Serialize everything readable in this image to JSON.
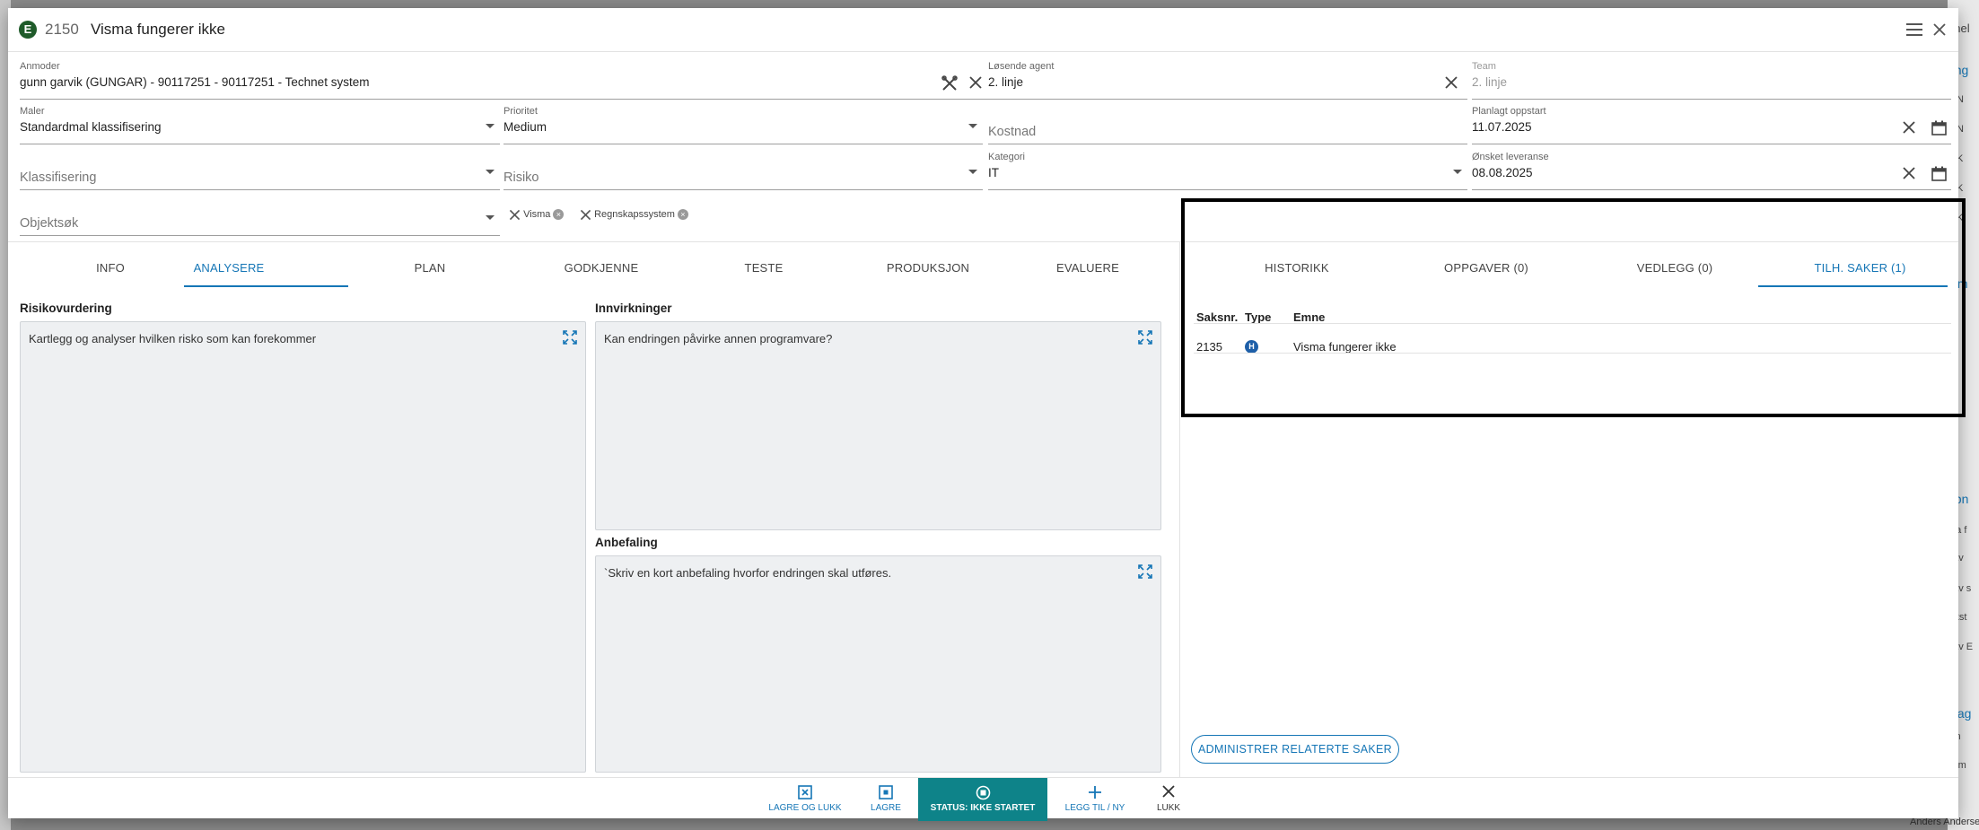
{
  "modal": {
    "badge": "E",
    "case_number": "2150",
    "title": "Visma fungerer ikke"
  },
  "fields": {
    "anmoder": {
      "label": "Anmoder",
      "value": "gunn garvik (GUNGAR) - 90117251 - 90117251 - Technet system"
    },
    "losende_agent": {
      "label": "Løsende agent",
      "value": "2. linje"
    },
    "team": {
      "label": "Team",
      "value": "2. linje"
    },
    "maler": {
      "label": "Maler",
      "value": "Standardmal klassifisering"
    },
    "prioritet": {
      "label": "Prioritet",
      "value": "Medium"
    },
    "kostnad": {
      "placeholder": "Kostnad"
    },
    "planlagt_oppstart": {
      "label": "Planlagt oppstart",
      "value": "11.07.2025"
    },
    "klassifisering": {
      "placeholder": "Klassifisering"
    },
    "risiko": {
      "placeholder": "Risiko"
    },
    "kategori": {
      "label": "Kategori",
      "value": "IT"
    },
    "onsket_leveranse": {
      "label": "Ønsket leveranse",
      "value": "08.08.2025"
    },
    "objektsok": {
      "placeholder": "Objektsøk"
    }
  },
  "chips": [
    "Visma",
    "Regnskapssystem"
  ],
  "left_tabs": [
    "INFO",
    "ANALYSERE",
    "PLAN",
    "GODKJENNE",
    "TESTE",
    "PRODUKSJON",
    "EVALUERE"
  ],
  "left_active_tab": "ANALYSERE",
  "sections": {
    "risikovurdering": {
      "title": "Risikovurdering",
      "text": "Kartlegg og analyser hvilken risko som kan forekommer"
    },
    "innvirkninger": {
      "title": "Innvirkninger",
      "text": "Kan endringen påvirke annen programvare?"
    },
    "anbefaling": {
      "title": "Anbefaling",
      "text": "`Skriv en kort anbefaling hvorfor endringen skal utføres."
    }
  },
  "right_tabs": [
    "HISTORIKK",
    "OPPGAVER (0)",
    "VEDLEGG (0)",
    "TILH. SAKER (1)"
  ],
  "right_active_tab": "TILH. SAKER (1)",
  "related": {
    "headers": [
      "Saksnr.",
      "Type",
      "Emne"
    ],
    "rows": [
      {
        "saksnr": "2135",
        "type": "H",
        "emne": "Visma fungerer ikke"
      }
    ],
    "admin_button": "ADMINISTRER RELATERTE SAKER"
  },
  "footer": {
    "save_close": "LAGRE OG LUKK",
    "save": "LAGRE",
    "status": "STATUS: IKKE STARTET",
    "add_new": "LEGG TIL / NY",
    "close": "LUKK"
  },
  "background_fragments": [
    "anel",
    "ring",
    "N",
    "N",
    "K",
    "K",
    "K",
    "tsm",
    "åpn",
    "ma f",
    "t av",
    "t av s",
    "Ekst",
    "t av E",
    "nlag",
    "nin",
    "kom",
    "ss",
    "k",
    "en",
    "Anders Anderse"
  ],
  "colors": {
    "accent": "#1576b6",
    "status_bg": "#0e8389",
    "badge_e": "#1f5b2a",
    "badge_h": "#1e5fa8",
    "textbox_bg": "#eef0f2"
  }
}
